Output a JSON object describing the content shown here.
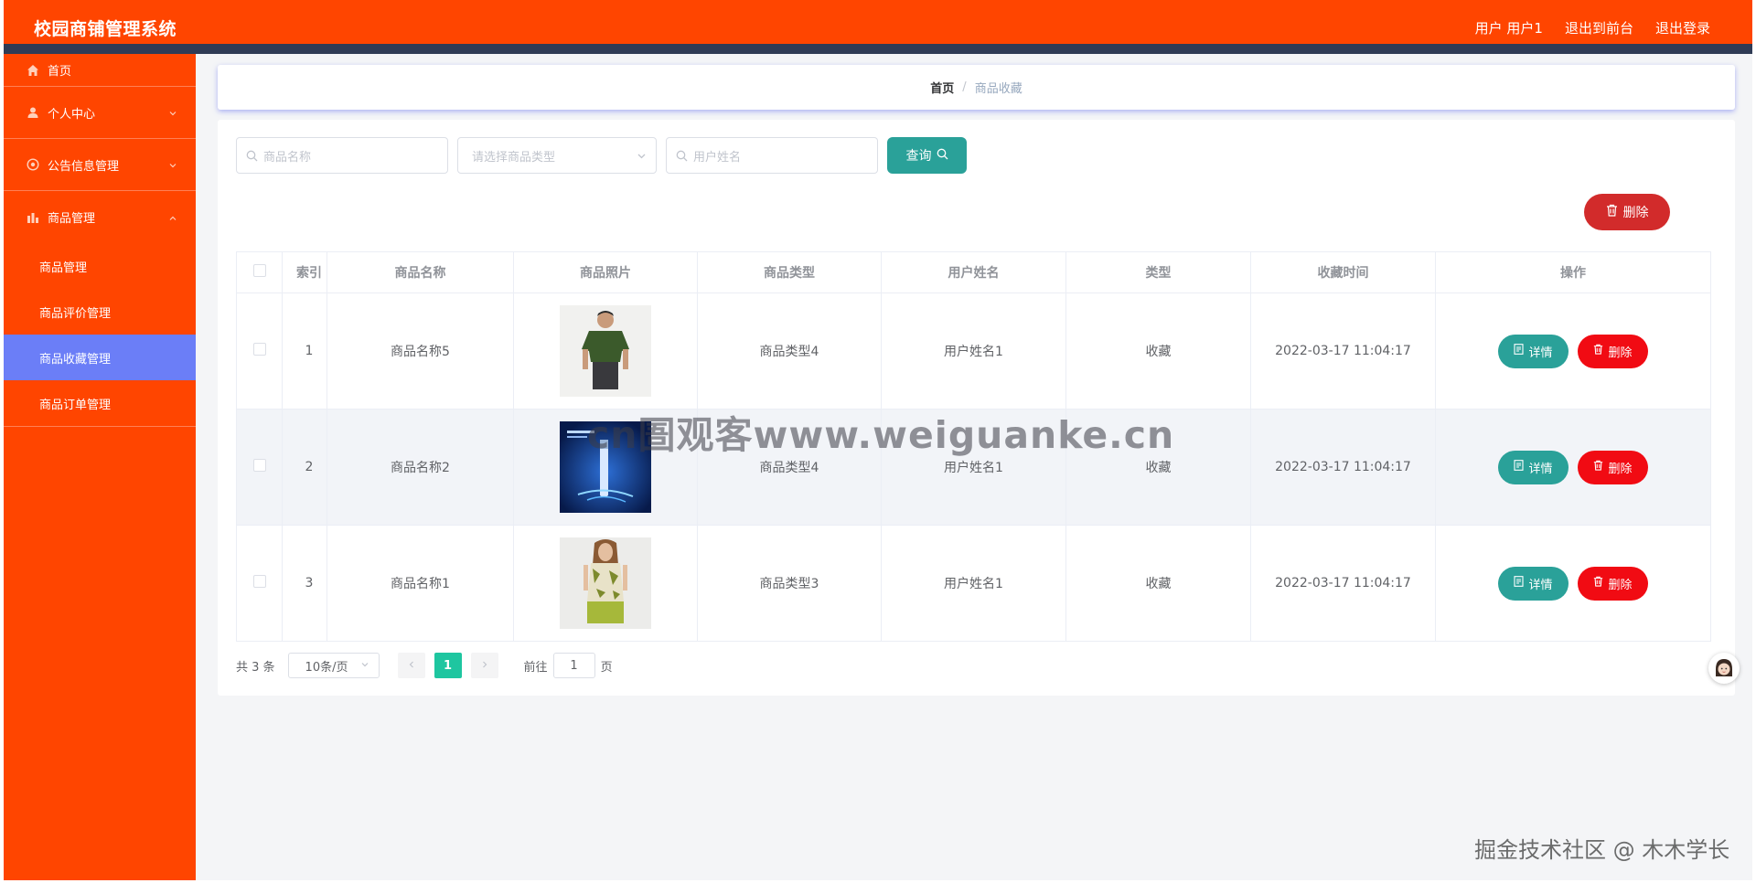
{
  "header": {
    "title": "校园商铺管理系统",
    "links": [
      "用户 用户1",
      "退出到前台",
      "退出登录"
    ]
  },
  "sidebar": {
    "items": [
      {
        "label": "首页",
        "icon": "home-icon"
      },
      {
        "label": "个人中心",
        "icon": "user-icon"
      },
      {
        "label": "公告信息管理",
        "icon": "notice-icon"
      },
      {
        "label": "商品管理",
        "icon": "chart-icon"
      }
    ],
    "sub_items": [
      "商品管理",
      "商品评价管理",
      "商品收藏管理",
      "商品订单管理"
    ],
    "active_sub": "商品收藏管理"
  },
  "breadcrumb": {
    "home": "首页",
    "separator": "/",
    "current": "商品收藏"
  },
  "search": {
    "name_placeholder": "商品名称",
    "type_placeholder": "请选择商品类型",
    "user_placeholder": "用户姓名",
    "query_label": "查询"
  },
  "toolbar": {
    "delete_label": "删除"
  },
  "table": {
    "headers": [
      "索引",
      "商品名称",
      "商品照片",
      "商品类型",
      "用户姓名",
      "类型",
      "收藏时间",
      "操作"
    ],
    "rows": [
      {
        "index": "1",
        "name": "商品名称5",
        "photo": "green-tshirt-man",
        "type": "商品类型4",
        "user": "用户姓名1",
        "kind": "收藏",
        "time": "2022-03-17 11:04:17"
      },
      {
        "index": "2",
        "name": "商品名称2",
        "photo": "blue-cosmetic-ad",
        "type": "商品类型4",
        "user": "用户姓名1",
        "kind": "收藏",
        "time": "2022-03-17 11:04:17"
      },
      {
        "index": "3",
        "name": "商品名称1",
        "photo": "floral-dress-woman",
        "type": "商品类型3",
        "user": "用户姓名1",
        "kind": "收藏",
        "time": "2022-03-17 11:04:17"
      }
    ],
    "detail_label": "详情",
    "delete_label": "删除"
  },
  "pagination": {
    "total": "共 3 条",
    "page_size": "10条/页",
    "current_page": "1",
    "goto_prefix": "前往",
    "goto_value": "1",
    "goto_suffix": "页"
  },
  "watermarks": {
    "center": "cn圄观客www.weiguanke.cn",
    "corner": "掘金技术社区 @ 木木学长"
  },
  "colors": {
    "primary": "#ff4500",
    "teal": "#2aa199",
    "danger": "#f10b13",
    "active": "#6b7ef7",
    "pager_active": "#1ec6a0"
  }
}
